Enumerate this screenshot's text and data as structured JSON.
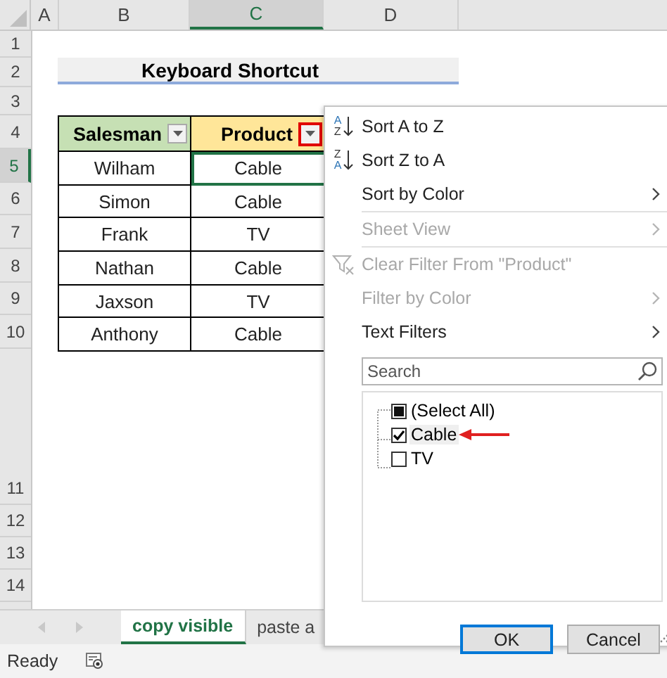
{
  "sheet": {
    "columns": [
      {
        "label": "A",
        "selected": false
      },
      {
        "label": "B",
        "selected": false
      },
      {
        "label": "C",
        "selected": true
      },
      {
        "label": "D",
        "selected": false
      }
    ],
    "row_numbers": [
      {
        "label": "1",
        "selected": false
      },
      {
        "label": "2",
        "selected": false
      },
      {
        "label": "3",
        "selected": false
      },
      {
        "label": "4",
        "selected": false
      },
      {
        "label": "5",
        "selected": true
      },
      {
        "label": "6",
        "selected": false
      },
      {
        "label": "7",
        "selected": false
      },
      {
        "label": "8",
        "selected": false
      },
      {
        "label": "9",
        "selected": false
      },
      {
        "label": "10",
        "selected": false
      }
    ],
    "lower_row_numbers": [
      "11",
      "12",
      "13",
      "14"
    ],
    "title": "Keyboard Shortcut",
    "table": {
      "headers": [
        {
          "label": "Salesman",
          "highlighted": false
        },
        {
          "label": "Product",
          "highlighted": true
        }
      ],
      "rows": [
        {
          "cells": [
            {
              "text": "Wilham",
              "active": false
            },
            {
              "text": "Cable",
              "active": true
            }
          ]
        },
        {
          "cells": [
            {
              "text": "Simon",
              "active": false
            },
            {
              "text": "Cable",
              "active": false
            }
          ]
        },
        {
          "cells": [
            {
              "text": "Frank",
              "active": false
            },
            {
              "text": "TV",
              "active": false
            }
          ]
        },
        {
          "cells": [
            {
              "text": "Nathan",
              "active": false
            },
            {
              "text": "Cable",
              "active": false
            }
          ]
        },
        {
          "cells": [
            {
              "text": "Jaxson",
              "active": false
            },
            {
              "text": "TV",
              "active": false
            }
          ]
        },
        {
          "cells": [
            {
              "text": "Anthony",
              "active": false
            },
            {
              "text": "Cable",
              "active": false
            }
          ]
        }
      ]
    }
  },
  "filter_menu": {
    "items": [
      {
        "kind": "sort-asc",
        "label": "Sort A to Z",
        "disabled": false,
        "submenu": false,
        "icon_letters": [
          "A",
          "Z"
        ]
      },
      {
        "kind": "sort-desc",
        "label": "Sort Z to A",
        "disabled": false,
        "submenu": false,
        "icon_letters": [
          "Z",
          "A"
        ]
      },
      {
        "kind": "plain",
        "label": "Sort by Color",
        "disabled": false,
        "submenu": true
      },
      {
        "kind": "plain",
        "label": "Sheet View",
        "disabled": true,
        "submenu": true
      },
      {
        "kind": "clear-filter",
        "label": "Clear Filter From \"Product\"",
        "disabled": true,
        "submenu": false
      },
      {
        "kind": "plain",
        "label": "Filter by Color",
        "disabled": true,
        "submenu": true
      },
      {
        "kind": "plain",
        "label": "Text Filters",
        "disabled": false,
        "submenu": true
      }
    ],
    "search": {
      "placeholder": "Search"
    },
    "select_all": {
      "label": "(Select All)",
      "mixed": true
    },
    "values": [
      {
        "label": "Cable",
        "checked": true,
        "annotated": true
      },
      {
        "label": "TV",
        "checked": false,
        "annotated": false
      }
    ],
    "buttons": [
      {
        "label": "OK",
        "default": true
      },
      {
        "label": "Cancel",
        "default": false
      }
    ]
  },
  "sheet_tabs": [
    {
      "label": "copy visible",
      "selected": true
    },
    {
      "label": "paste a",
      "selected": false
    }
  ],
  "status_bar": {
    "text": "Ready"
  }
}
